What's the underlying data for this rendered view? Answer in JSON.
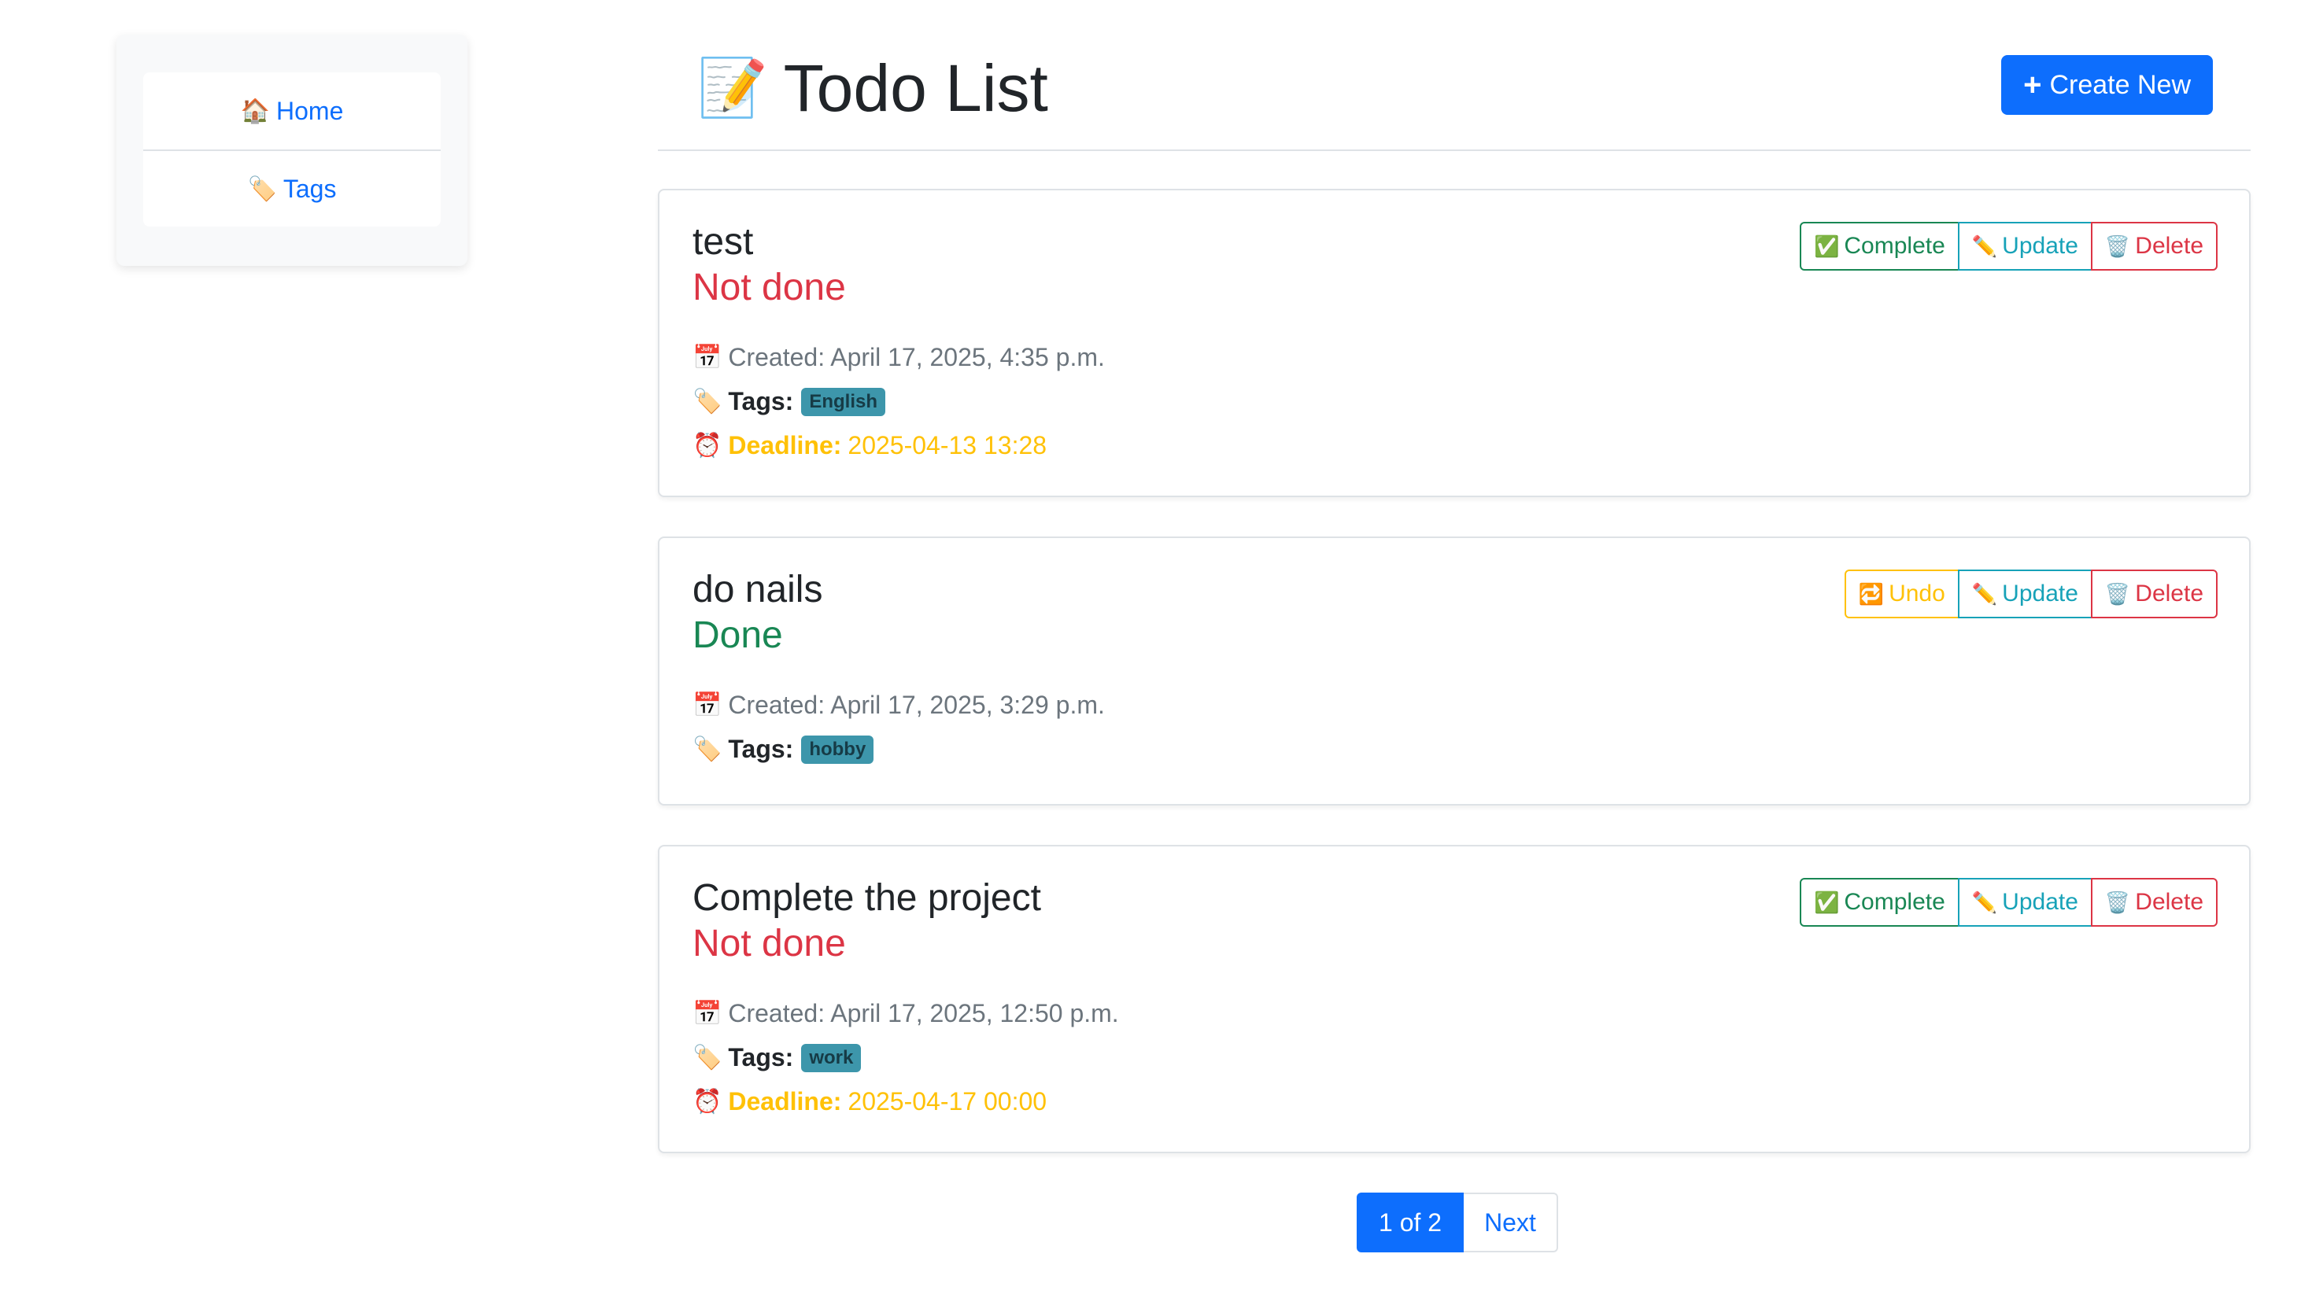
{
  "sidebar": {
    "items": [
      {
        "icon": "house-icon",
        "glyph": "🏠",
        "label": "Home"
      },
      {
        "icon": "tag-icon",
        "glyph": "🏷️",
        "label": "Tags"
      }
    ]
  },
  "header": {
    "title_icon": "📝",
    "title": "Todo List",
    "create_icon": "+",
    "create_label": "Create New"
  },
  "labels": {
    "tags": "Tags:",
    "deadline": "Deadline:"
  },
  "todos": [
    {
      "title": "test",
      "status": "Not done",
      "created": "Created: April 17, 2025, 4:35 p.m.",
      "tag": "English",
      "deadline": "2025-04-13 13:28",
      "actions": {
        "primary": "Complete",
        "primary_glyph": "✅",
        "update": "Update",
        "update_glyph": "✏️",
        "delete": "Delete",
        "delete_glyph": "🗑️"
      }
    },
    {
      "title": "do nails",
      "status": "Done",
      "created": "Created: April 17, 2025, 3:29 p.m.",
      "tag": "hobby",
      "deadline": "",
      "actions": {
        "primary": "Undo",
        "primary_glyph": "🔁",
        "update": "Update",
        "update_glyph": "✏️",
        "delete": "Delete",
        "delete_glyph": "🗑️"
      }
    },
    {
      "title": "Complete the project",
      "status": "Not done",
      "created": "Created: April 17, 2025, 12:50 p.m.",
      "tag": "work",
      "deadline": "2025-04-17 00:00",
      "actions": {
        "primary": "Complete",
        "primary_glyph": "✅",
        "update": "Update",
        "update_glyph": "✏️",
        "delete": "Delete",
        "delete_glyph": "🗑️"
      }
    }
  ],
  "icons": {
    "calendar": "📅",
    "tag": "🏷️",
    "alarm": "⏰"
  },
  "pagination": {
    "current": "1 of 2",
    "next": "Next"
  },
  "colors": {
    "primary": "#0d6efd",
    "danger": "#dc3545",
    "success": "#198754",
    "warning": "#ffc107",
    "info": "#17a2b8",
    "badge": "#3d96ab"
  }
}
